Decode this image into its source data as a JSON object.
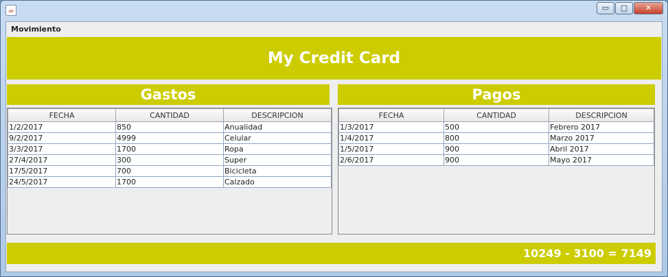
{
  "window": {
    "icon": "java-cup-icon",
    "controls": {
      "minimize": "▭",
      "maximize": "□",
      "close": "✕"
    }
  },
  "menu": {
    "items": [
      "Movimiento"
    ]
  },
  "banner": {
    "title": "My Credit Card"
  },
  "gastos": {
    "title": "Gastos",
    "columns": [
      "FECHA",
      "CANTIDAD",
      "DESCRIPCION"
    ],
    "rows": [
      [
        "1/2/2017",
        "850",
        "Anualidad"
      ],
      [
        "9/2/2017",
        "4999",
        "Celular"
      ],
      [
        "3/3/2017",
        "1700",
        "Ropa"
      ],
      [
        "27/4/2017",
        "300",
        "Super"
      ],
      [
        "17/5/2017",
        "700",
        "Bicicleta"
      ],
      [
        "24/5/2017",
        "1700",
        "Calzado"
      ]
    ]
  },
  "pagos": {
    "title": "Pagos",
    "columns": [
      "FECHA",
      "CANTIDAD",
      "DESCRIPCION"
    ],
    "rows": [
      [
        "1/3/2017",
        "500",
        "Febrero 2017"
      ],
      [
        "1/4/2017",
        "800",
        "Marzo 2017"
      ],
      [
        "1/5/2017",
        "900",
        "Abril 2017"
      ],
      [
        "2/6/2017",
        "900",
        "Mayo 2017"
      ]
    ]
  },
  "summary": {
    "text": "10249 - 3100 = 7149"
  },
  "colors": {
    "accent": "#cccc00",
    "panel": "#eeeeee"
  }
}
